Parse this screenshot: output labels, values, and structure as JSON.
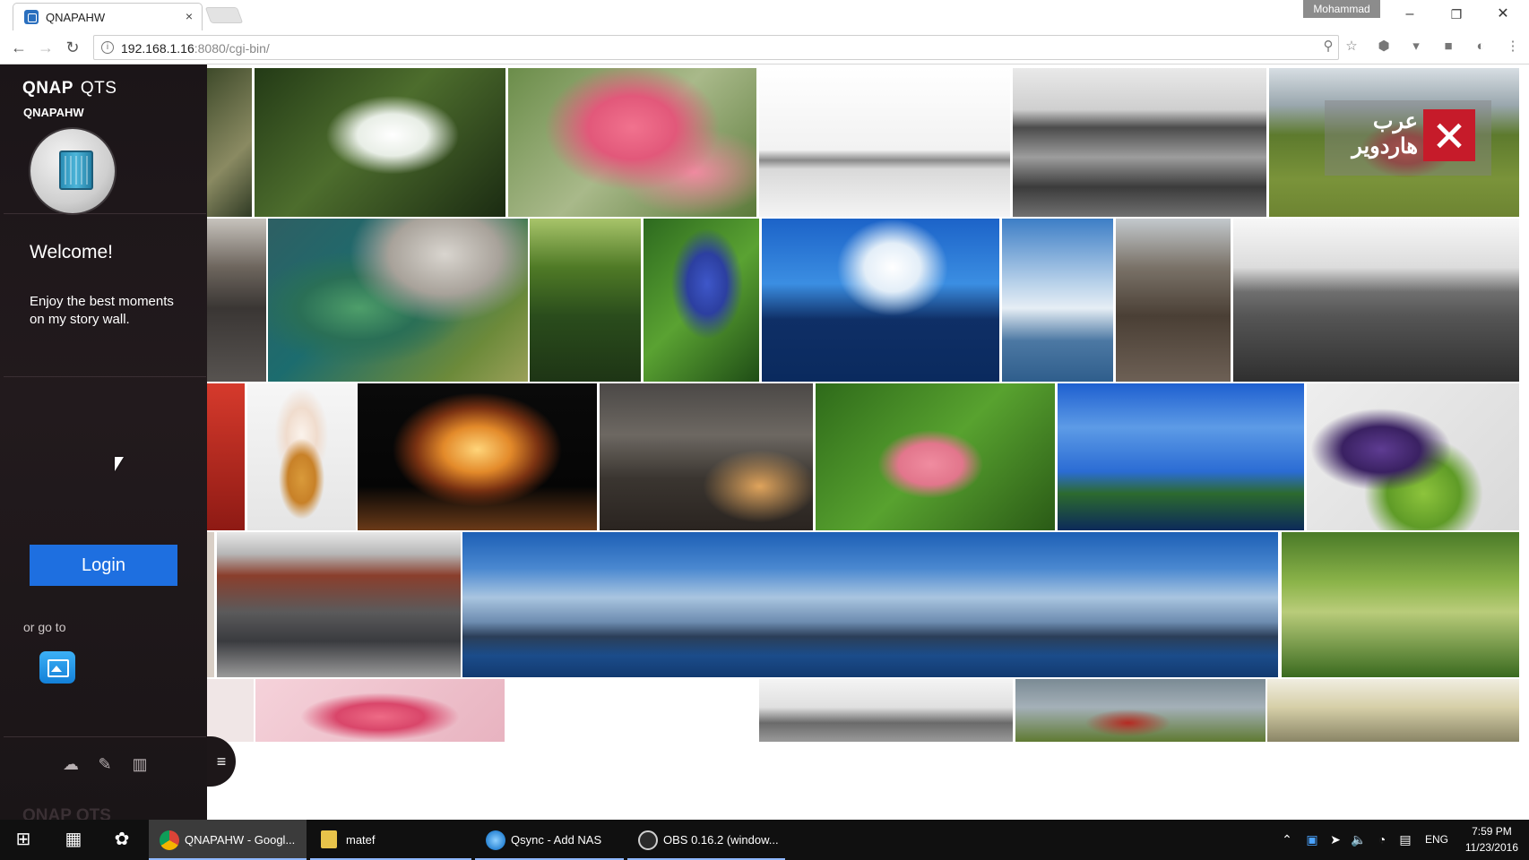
{
  "browser": {
    "tab_title": "QNAPAHW",
    "profile_name": "Mohammad",
    "url_host": "192.168.1.16",
    "url_rest": ":8080/cgi-bin/"
  },
  "sidebar": {
    "brand": "QNAP",
    "brand_sub": "QTS",
    "device_name": "QNAPAHW",
    "welcome_title": "Welcome!",
    "welcome_message": "Enjoy the best moments on my story wall.",
    "login_label": "Login",
    "or_go_to": "or go to"
  },
  "watermark": {
    "line1": "عرب",
    "line2": "هاردوير"
  },
  "taskbar": {
    "items": [
      {
        "label": "QNAPAHW - Googl...",
        "icon": "chrome-icon"
      },
      {
        "label": "matef",
        "icon": "folder-icon"
      },
      {
        "label": "Qsync - Add NAS",
        "icon": "qsync-icon"
      },
      {
        "label": "OBS 0.16.2 (window...",
        "icon": "obs-icon"
      }
    ],
    "language": "ENG",
    "time": "7:59 PM",
    "date": "11/23/2016"
  },
  "colors": {
    "login_button": "#1e6fe0",
    "sidebar_bg": "#1b1518",
    "taskbar_bg": "#101010"
  }
}
